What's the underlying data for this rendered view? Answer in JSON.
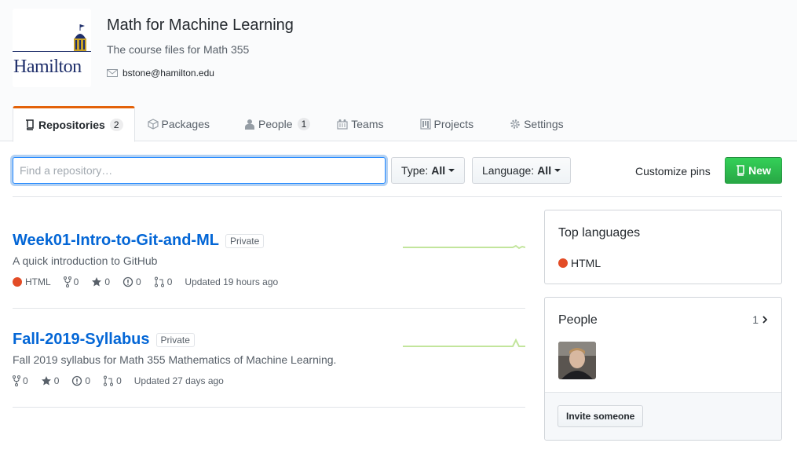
{
  "org": {
    "logo_text": "Hamilton",
    "name": "Math for Machine Learning",
    "description": "The course files for Math 355",
    "email": "bstone@hamilton.edu"
  },
  "tabs": [
    {
      "label": "Repositories",
      "count": "2",
      "icon": "repo-icon",
      "selected": true
    },
    {
      "label": "Packages",
      "icon": "package-icon"
    },
    {
      "label": "People",
      "count": "1",
      "icon": "person-icon"
    },
    {
      "label": "Teams",
      "icon": "team-icon"
    },
    {
      "label": "Projects",
      "icon": "project-icon"
    },
    {
      "label": "Settings",
      "icon": "gear-icon"
    }
  ],
  "filters": {
    "search_placeholder": "Find a repository…",
    "type_label": "Type:",
    "type_value": "All",
    "language_label": "Language:",
    "language_value": "All",
    "customize_pins": "Customize pins",
    "new_button": "New"
  },
  "repos": [
    {
      "name": "Week01-Intro-to-Git-and-ML",
      "visibility": "Private",
      "description": "A quick introduction to GitHub",
      "language": "HTML",
      "forks": "0",
      "stars": "0",
      "issues": "0",
      "pulls": "0",
      "updated": "Updated 19 hours ago"
    },
    {
      "name": "Fall-2019-Syllabus",
      "visibility": "Private",
      "description": "Fall 2019 syllabus for Math 355 Mathematics of Machine Learning.",
      "forks": "0",
      "stars": "0",
      "issues": "0",
      "pulls": "0",
      "updated": "Updated 27 days ago"
    }
  ],
  "sidebar": {
    "top_languages_title": "Top languages",
    "top_language": "HTML",
    "language_color": "#e34c26",
    "people_title": "People",
    "people_count": "1",
    "invite_button": "Invite someone"
  },
  "colors": {
    "link": "#0366d6",
    "accent_tab": "#e36209",
    "new_button": "#28a745"
  }
}
